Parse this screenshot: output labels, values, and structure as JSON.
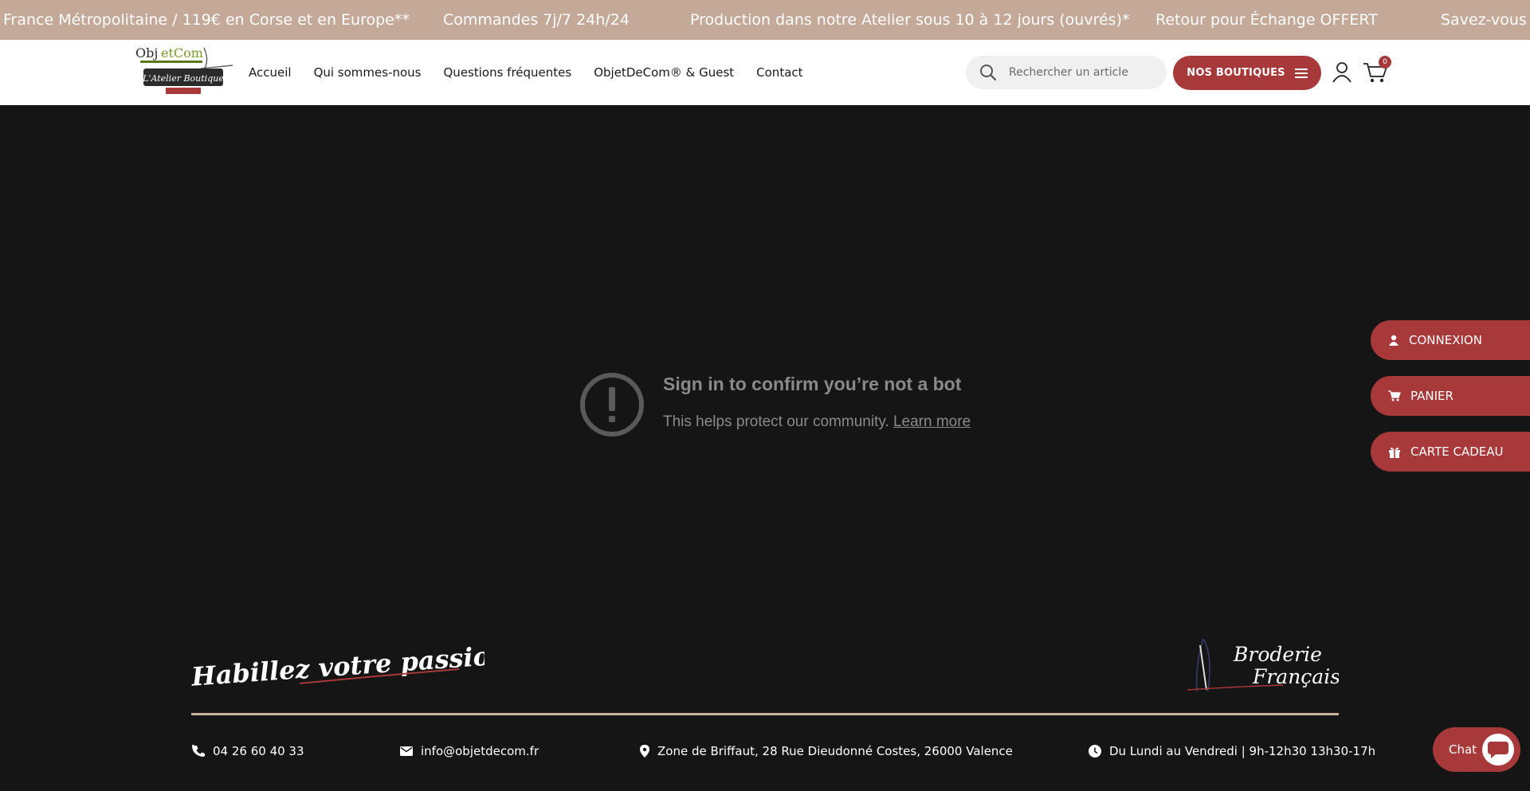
{
  "ticker": {
    "items": [
      "France Métropolitaine / 119€ en Corse et en Europe**",
      "Commandes 7j/7 24h/24",
      "Production dans notre Atelier sous 10 à 12 jours (ouvrés)*",
      "Retour pour Échange OFFERT",
      "Savez-vous q"
    ]
  },
  "header": {
    "logo_alt": "ObjetDeCom L'Atelier Boutique",
    "nav": [
      "Accueil",
      "Qui sommes-nous",
      "Questions fréquentes",
      "ObjetDeCom® & Guest",
      "Contact"
    ],
    "search_placeholder": "Rechercher un article",
    "stores_label": "NOS BOUTIQUES",
    "cart_count": "0"
  },
  "main": {
    "title": "Sign in to confirm you’re not a bot",
    "text": "This helps protect our community.",
    "link": "Learn more"
  },
  "side_buttons": [
    "CONNEXION",
    "PANIER",
    "CARTE CADEAU"
  ],
  "footer": {
    "slogan": "Habillez votre passion !",
    "brand": [
      "Broderie",
      "Française"
    ],
    "phone": "04 26 60 40 33",
    "email": "info@objetdecom.fr",
    "address": "Zone de Briffaut, 28 Rue Dieudonné Costes, 26000 Valence",
    "hours": "Du Lundi au Vendredi | 9h-12h30 13h30-17h"
  },
  "chat": {
    "label": "Chat"
  },
  "colors": {
    "ticker_bg": "#c4a898",
    "accent": "#a8393a",
    "page_bg": "#151515",
    "footer_line": "#c8b49a"
  }
}
